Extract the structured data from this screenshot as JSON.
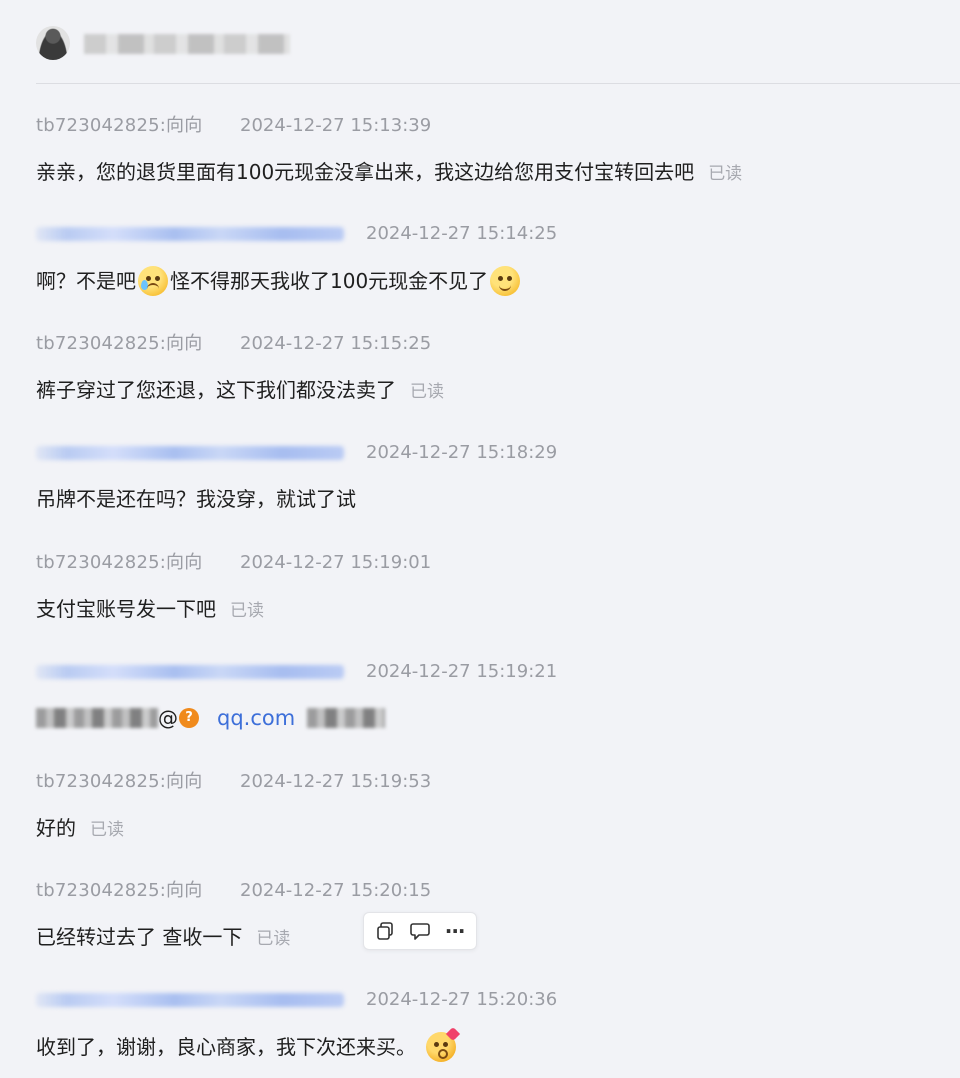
{
  "header": {
    "avatar_icon": "user-avatar"
  },
  "read_label": "已读",
  "messages": [
    {
      "sender": "tb723042825:向向",
      "time": "2024-12-27 15:13:39",
      "text": "亲亲，您的退货里面有100元现金没拿出来，我这边给您用支付宝转回去吧",
      "read": true
    },
    {
      "sender": "",
      "time": "2024-12-27 15:14:25",
      "text_part1": "啊？不是吧",
      "text_part2": "怪不得那天我收了100元现金不见了",
      "emoji1": "crying-emoji",
      "emoji2": "dizzy-emoji"
    },
    {
      "sender": "tb723042825:向向",
      "time": "2024-12-27 15:15:25",
      "text": "裤子穿过了您还退，这下我们都没法卖了",
      "read": true
    },
    {
      "sender": "",
      "time": "2024-12-27 15:18:29",
      "text": "吊牌不是还在吗？我没穿，就试了试"
    },
    {
      "sender": "tb723042825:向向",
      "time": "2024-12-27 15:19:01",
      "text": "支付宝账号发一下吧",
      "read": true
    },
    {
      "sender": "",
      "time": "2024-12-27 15:19:21",
      "at": "@",
      "qmark": "?",
      "link": "qq.com"
    },
    {
      "sender": "tb723042825:向向",
      "time": "2024-12-27 15:19:53",
      "text": "好的",
      "read": true
    },
    {
      "sender": "tb723042825:向向",
      "time": "2024-12-27 15:20:15",
      "text": "已经转过去了 查收一下",
      "read": true
    },
    {
      "sender": "",
      "time": "2024-12-27 15:20:36",
      "text": "收到了，谢谢，良心商家，我下次还来买。",
      "emoji": "kiss-emoji"
    }
  ],
  "toolbar": {
    "copy_icon": "copy-icon",
    "reply_icon": "quote-reply-icon",
    "more_label": "···"
  }
}
